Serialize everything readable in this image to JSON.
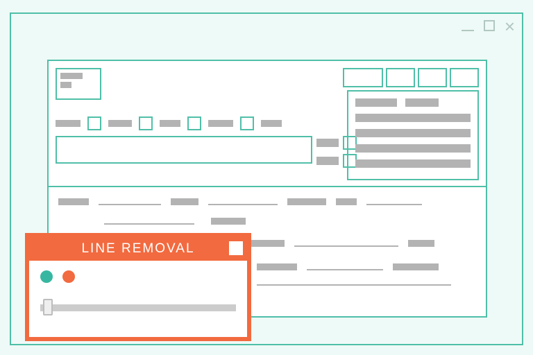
{
  "window": {
    "controls": {
      "minimize": "minimize",
      "maximize": "maximize",
      "close": "close"
    }
  },
  "dialog": {
    "title": "LINE REMOVAL",
    "options": {
      "a": "teal",
      "b": "orange"
    },
    "slider_value": 0
  },
  "colors": {
    "accent_teal": "#4fbfa8",
    "accent_orange": "#f26a3f",
    "placeholder": "#b3b3b3"
  }
}
